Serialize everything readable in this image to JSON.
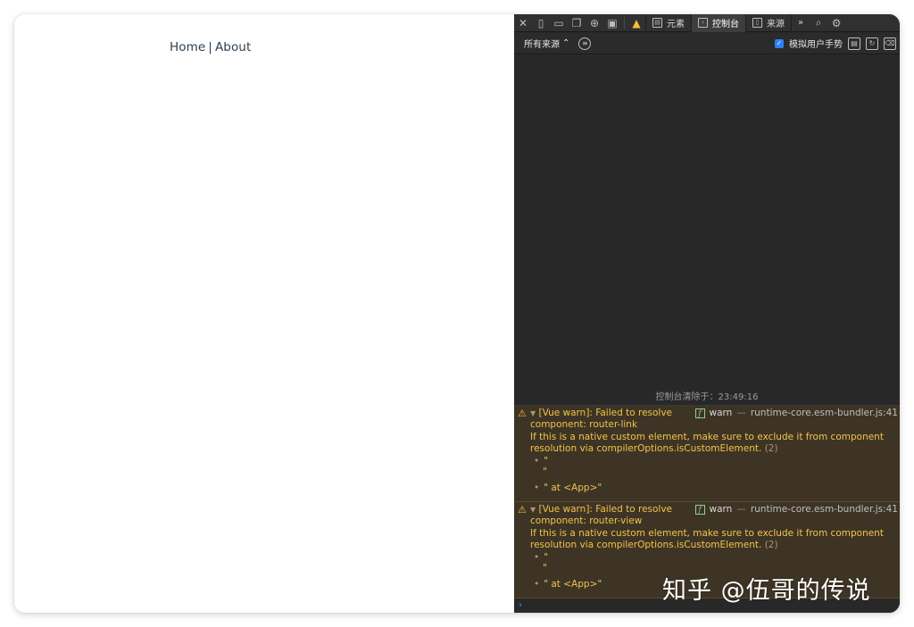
{
  "page": {
    "nav": {
      "home": "Home",
      "separator": "|",
      "about": "About"
    }
  },
  "devtools": {
    "toolbar": {
      "tabs": [
        {
          "label": "元素",
          "icon": "elements-icon"
        },
        {
          "label": "控制台",
          "icon": "console-icon"
        },
        {
          "label": "来源",
          "icon": "sources-icon"
        }
      ],
      "more": "»"
    },
    "filterbar": {
      "source_select": "所有来源",
      "emulate_gesture": "模拟用户手势"
    },
    "cleared_message": "控制台清除于：23:49:16",
    "messages": [
      {
        "line1": "[Vue warn]: Failed to resolve",
        "line2": "component: router-link",
        "line3": "If this is a native custom element, make sure to exclude it from component",
        "line4": "resolution via compilerOptions.isCustomElement.",
        "count": "(2)",
        "arg1": "\"",
        "arg1b": "\"",
        "arg2": "\" at <App>\"",
        "level": "warn",
        "source": "runtime-core.esm-bundler.js:41"
      },
      {
        "line1": "[Vue warn]: Failed to resolve",
        "line2": "component: router-view",
        "line3": "If this is a native custom element, make sure to exclude it from component",
        "line4": "resolution via compilerOptions.isCustomElement.",
        "count": "(2)",
        "arg1": "\"",
        "arg1b": "\"",
        "arg2": "\" at <App>\"",
        "level": "warn",
        "source": "runtime-core.esm-bundler.js:41"
      }
    ],
    "prompt": "›"
  },
  "watermark": "知乎 @伍哥的传说",
  "colors": {
    "warning_bg": "#3e3425",
    "warning_text": "#f0c44a",
    "devtools_bg": "#282828"
  }
}
